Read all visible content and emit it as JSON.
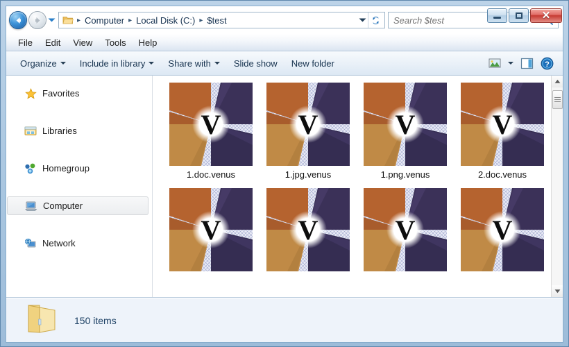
{
  "window": {
    "controls": {
      "minimize_label": "Minimize",
      "maximize_label": "Restore",
      "close_label": "✕"
    }
  },
  "navigation": {
    "back_label": "Back",
    "forward_label": "Forward",
    "recent_pages_label": "Recent pages",
    "refresh_label": "Refresh",
    "address_dropdown_label": "Previous locations"
  },
  "breadcrumb": {
    "separator": "▸",
    "items": [
      {
        "label": "Computer"
      },
      {
        "label": "Local Disk (C:)"
      },
      {
        "label": "$test"
      }
    ]
  },
  "search": {
    "placeholder": "Search $test",
    "value": "",
    "icon": "search-icon"
  },
  "menubar": {
    "items": [
      {
        "label": "File"
      },
      {
        "label": "Edit"
      },
      {
        "label": "View"
      },
      {
        "label": "Tools"
      },
      {
        "label": "Help"
      }
    ]
  },
  "toolbar": {
    "organize_label": "Organize",
    "include_label": "Include in library",
    "share_label": "Share with",
    "slideshow_label": "Slide show",
    "newfolder_label": "New folder",
    "change_view_label": "Change your view",
    "view_dropdown_label": "More options",
    "preview_pane_label": "Show the preview pane",
    "help_label": "Get help"
  },
  "sidebar": {
    "items": [
      {
        "label": "Favorites",
        "icon": "star-icon",
        "selected": false
      },
      {
        "label": "Libraries",
        "icon": "libraries-icon",
        "selected": false
      },
      {
        "label": "Homegroup",
        "icon": "homegroup-icon",
        "selected": false
      },
      {
        "label": "Computer",
        "icon": "computer-icon",
        "selected": true
      },
      {
        "label": "Network",
        "icon": "network-icon",
        "selected": false
      }
    ]
  },
  "files": {
    "items": [
      {
        "name": "1.doc.venus",
        "thumbnail": "venus-logo"
      },
      {
        "name": "1.jpg.venus",
        "thumbnail": "venus-logo"
      },
      {
        "name": "1.png.venus",
        "thumbnail": "venus-logo"
      },
      {
        "name": "2.doc.venus",
        "thumbnail": "venus-logo"
      },
      {
        "name": "",
        "thumbnail": "venus-logo"
      },
      {
        "name": "",
        "thumbnail": "venus-logo"
      },
      {
        "name": "",
        "thumbnail": "venus-logo"
      },
      {
        "name": "",
        "thumbnail": "venus-logo"
      }
    ]
  },
  "statusbar": {
    "icon": "folder-icon",
    "item_count_text": "150 items"
  },
  "colors": {
    "frame": "#a9c6e0",
    "accent_blue": "#1857a0",
    "close_red": "#c63a32",
    "statusbar_bg": "#eef3fa",
    "thumb_orange": "#b5632f",
    "thumb_purple": "#3b3158",
    "thumb_gold": "#c08a46",
    "thumb_lattice": "#e8eaf4"
  }
}
